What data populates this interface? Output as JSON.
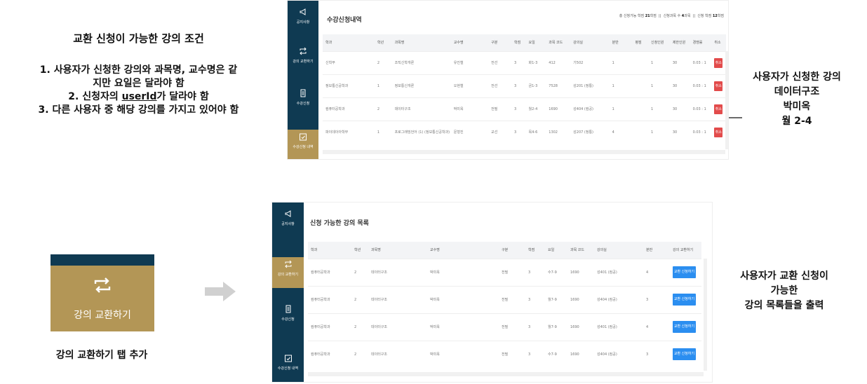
{
  "conditions": {
    "title": "교환 신청이 가능한 강의 조건",
    "line1a": "1.  사용자가 신청한 강의와 과목명, 교수명은 같",
    "line1b": "지만 요일은 달라야 함",
    "line2_pre": "2.  신청자의 ",
    "line2_u": "userId",
    "line2_post": "가 달라야 함",
    "line3": "3.  다른 사용자 중 해당 강의를 가지고 있어야 함"
  },
  "tab_preview": {
    "label": "강의 교환하기",
    "caption": "강의 교환하기 탭 추가",
    "icon": "swap-icon"
  },
  "note1": [
    "사용자가 신청한 강의",
    "데이터구조",
    "박미옥",
    "월 2-4"
  ],
  "note2": [
    "사용자가 교환 신청이",
    "가능한",
    "강의 목록들을 출력"
  ],
  "sidebar": {
    "notice": "공지사항",
    "exchange": "강의 교환하기",
    "enroll": "수강신청",
    "history": "수강신청 내역"
  },
  "screen1": {
    "title": "수강신청내역",
    "summary": {
      "max_label": "총 신청가능 학점",
      "max_value": "21",
      "max_unit": "학점",
      "count_label": "신청과목 수",
      "count_value": "4",
      "count_unit": "과목",
      "credit_label": "신청 학점",
      "credit_value": "12",
      "credit_unit": "학점",
      "sep": "||"
    },
    "columns": [
      "학과",
      "학년",
      "과목명",
      "교수명",
      "구분",
      "학점",
      "요일",
      "과목 코드",
      "강의실",
      "분반",
      "평점",
      "신청인원",
      "제한인원",
      "경쟁률",
      "취소"
    ],
    "rows": [
      [
        "신학부",
        "2",
        "조직신학개론",
        "유진철",
        "전선",
        "3",
        "화1-3",
        "412",
        "기502",
        "1",
        "",
        "1",
        "30",
        "0.03 : 1"
      ],
      [
        "정보통신공학과",
        "1",
        "정보통신개론",
        "오현철",
        "전선",
        "3",
        "금1-3",
        "7528",
        "성201 (정통)",
        "1",
        "",
        "1",
        "30",
        "0.03 : 1"
      ],
      [
        "컴퓨터공학과",
        "2",
        "데이터구조",
        "박미옥",
        "전필",
        "3",
        "월2-4",
        "1690",
        "성404 (컴공)",
        "1",
        "",
        "1",
        "30",
        "0.03 : 1"
      ],
      [
        "파이데이아학부",
        "1",
        "프로그래밍언어 (1) (정보통신공학과)",
        "문형진",
        "교선",
        "3",
        "목4-6",
        "1302",
        "성207 (정통)",
        "4",
        "",
        "1",
        "30",
        "0.03 : 1"
      ]
    ],
    "cancel_label": "취소"
  },
  "screen2": {
    "title": "신청 가능한 강의 목록",
    "columns": [
      "학과",
      "학년",
      "과목명",
      "교수명",
      "구분",
      "학점",
      "요일",
      "과목 코드",
      "강의실",
      "분반",
      "강의 교환하기"
    ],
    "rows": [
      [
        "컴퓨터공학과",
        "2",
        "데이터구조",
        "박미옥",
        "전필",
        "3",
        "수7-9",
        "1690",
        "성401 (컴공)",
        "4"
      ],
      [
        "컴퓨터공학과",
        "2",
        "데이터구조",
        "박미옥",
        "전필",
        "3",
        "월7-9",
        "1690",
        "성404 (컴공)",
        "3"
      ],
      [
        "컴퓨터공학과",
        "2",
        "데이터구조",
        "박미옥",
        "전필",
        "3",
        "월7-9",
        "1690",
        "성401 (컴공)",
        "4"
      ],
      [
        "컴퓨터공학과",
        "2",
        "데이터구조",
        "박미옥",
        "전필",
        "3",
        "수7-9",
        "1690",
        "성404 (컴공)",
        "3"
      ]
    ],
    "exchange_label": "교환 신청하기"
  }
}
